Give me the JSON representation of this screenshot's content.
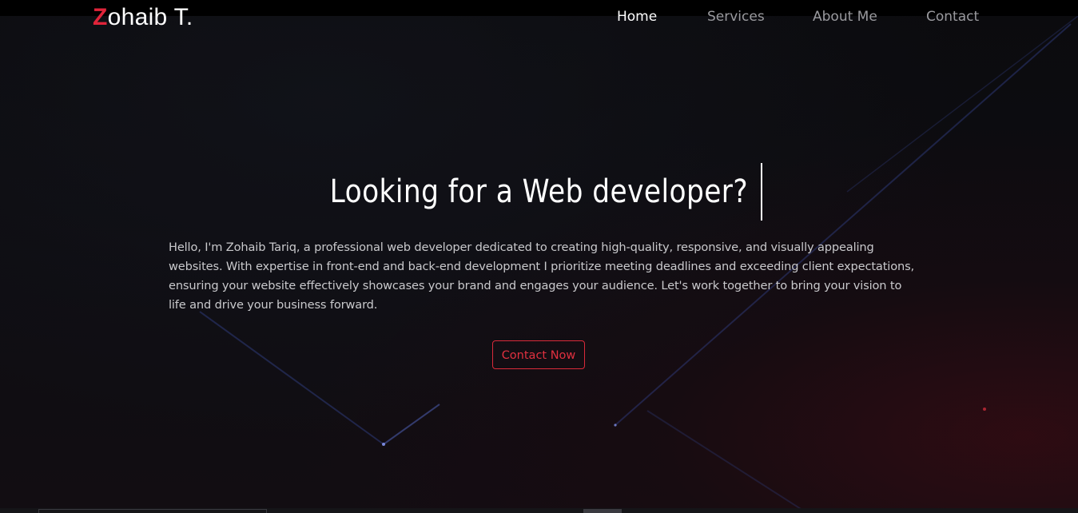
{
  "brand": {
    "logo_initial": "Z",
    "logo_rest": "ohaib T.",
    "accent_color": "#e0243a"
  },
  "nav": {
    "items": [
      {
        "label": "Home",
        "active": true
      },
      {
        "label": "Services",
        "active": false
      },
      {
        "label": "About Me",
        "active": false
      },
      {
        "label": "Contact",
        "active": false
      }
    ]
  },
  "hero": {
    "headline": "Looking for a Web developer?",
    "intro": "Hello, I'm Zohaib Tariq, a professional web developer dedicated to creating high-quality, responsive, and visually appealing websites. With expertise in front-end and back-end development I prioritize meeting deadlines and exceeding client expectations, ensuring your website effectively showcases your brand and engages your audience. Let's work together to bring your vision to life and drive your business forward.",
    "cta_label": "Contact Now"
  }
}
